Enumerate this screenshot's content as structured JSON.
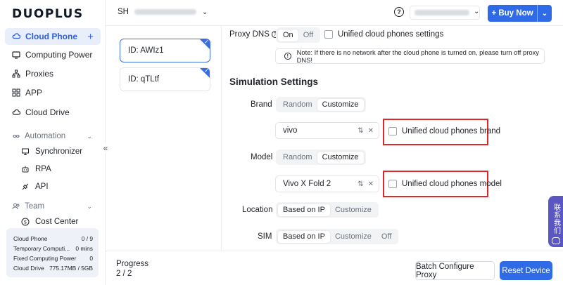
{
  "brand": {
    "logo": "DUOPLUS"
  },
  "sidebar": {
    "items": [
      {
        "label": "Cloud Phone",
        "icon": "cloud-phone-icon",
        "action": "+"
      },
      {
        "label": "Computing Power",
        "icon": "monitor-icon"
      },
      {
        "label": "Proxies",
        "icon": "network-icon"
      },
      {
        "label": "APP",
        "icon": "grid-icon"
      },
      {
        "label": "Cloud Drive",
        "icon": "cloud-icon"
      }
    ],
    "automation": {
      "label": "Automation",
      "items": [
        {
          "label": "Synchronizer",
          "icon": "sync-icon"
        },
        {
          "label": "RPA",
          "icon": "robot-icon"
        },
        {
          "label": "API",
          "icon": "api-icon"
        }
      ]
    },
    "team": {
      "label": "Team",
      "items": [
        {
          "label": "Cost Center",
          "icon": "dollar-icon"
        }
      ]
    },
    "usage": [
      {
        "label": "Cloud Phone",
        "value": "0 / 9"
      },
      {
        "label": "Temporary Computi...",
        "value": "0 mins"
      },
      {
        "label": "Fixed Computing Power",
        "value": "0"
      },
      {
        "label": "Cloud Drive",
        "value": "775.17MB / 5GB"
      }
    ],
    "collapse": "«"
  },
  "header": {
    "workspace_initials": "SH",
    "buy_now": "+ Buy Now",
    "help": "?"
  },
  "devices": [
    {
      "label": "ID: AWIz1",
      "selected": true
    },
    {
      "label": "ID: qTLtf",
      "selected": false
    }
  ],
  "settings": {
    "proxy_dns": {
      "label": "Proxy DNS",
      "options": [
        "On",
        "Off"
      ],
      "selected": "On",
      "unified_label": "Unified cloud phones settings",
      "note": "Note: If there is no network after the cloud phone is turned on, please turn off proxy DNS!"
    },
    "simulation_title": "Simulation Settings",
    "brand": {
      "label": "Brand",
      "options": [
        "Random",
        "Customize"
      ],
      "selected": "Customize",
      "value": "vivo",
      "unified_label": "Unified cloud phones brand"
    },
    "model": {
      "label": "Model",
      "options": [
        "Random",
        "Customize"
      ],
      "selected": "Customize",
      "value": "Vivo X Fold 2",
      "unified_label": "Unified cloud phones model"
    },
    "location": {
      "label": "Location",
      "options": [
        "Based on IP",
        "Customize"
      ],
      "selected": "Based on IP"
    },
    "sim": {
      "label": "SIM",
      "options": [
        "Based on IP",
        "Customize",
        "Off"
      ],
      "selected": "Based on IP"
    }
  },
  "footer": {
    "progress_label": "Progress",
    "progress_value": "2 / 2",
    "batch_button": "Batch Configure Proxy",
    "reset_button": "Reset Device"
  },
  "contact_widget": {
    "label": "联系我们"
  },
  "colors": {
    "primary": "#2f6be6",
    "highlight_box": "#e0262d",
    "widget": "#5a57c4"
  }
}
